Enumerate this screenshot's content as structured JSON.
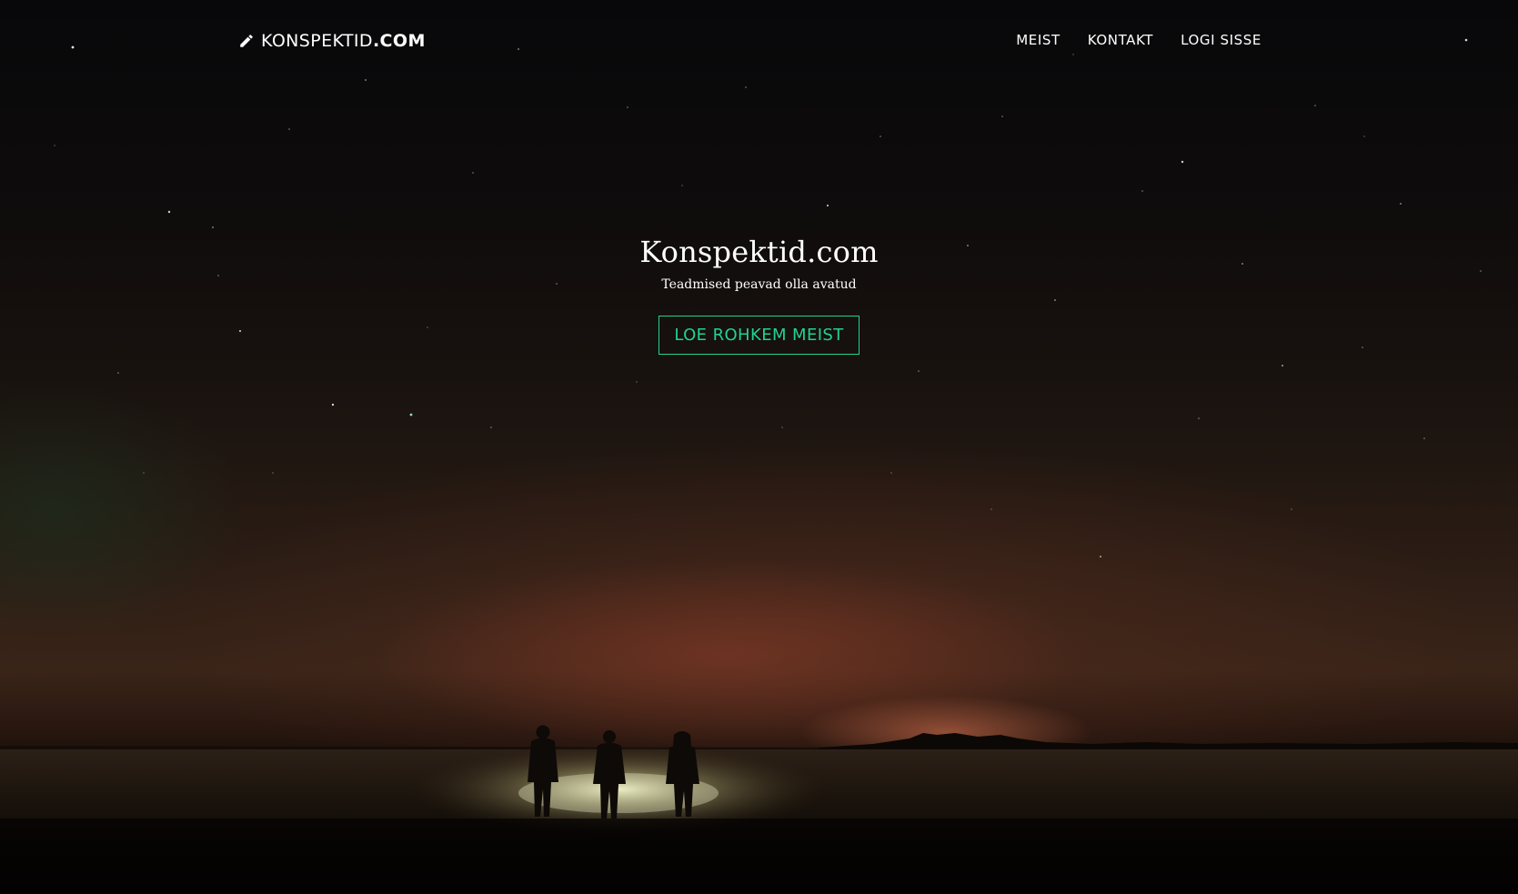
{
  "nav": {
    "brand_icon": "pencil-icon",
    "brand_name": "KONSPEKTID",
    "brand_tld": ".COM",
    "links": [
      {
        "label": "MEIST"
      },
      {
        "label": "KONTAKT"
      },
      {
        "label": "LOGI SISSE"
      }
    ]
  },
  "hero": {
    "title": "Konspektid.com",
    "subtitle": "Teadmised peavad olla avatud",
    "cta_label": "LOE ROHKEM MEIST"
  },
  "colors": {
    "accent": "#20d38f",
    "text": "#ffffff",
    "background": "#0a0808"
  }
}
